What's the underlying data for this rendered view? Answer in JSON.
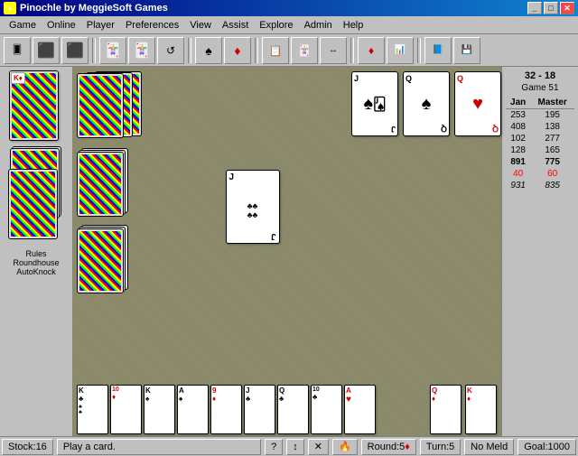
{
  "titleBar": {
    "title": "Pinochle by MeggieSoft Games",
    "icon": "♦",
    "buttons": [
      "_",
      "□",
      "✕"
    ]
  },
  "menuBar": {
    "items": [
      "Game",
      "Online",
      "Player",
      "Preferences",
      "View",
      "Assist",
      "Explore",
      "Admin",
      "Help"
    ]
  },
  "toolbar": {
    "buttons": [
      "🃏",
      "📋",
      "📋",
      "🃏",
      "🃏",
      "🔄",
      "♠",
      "♠",
      "📃",
      "🃏",
      "🔄",
      "♦",
      "📊",
      "🃏",
      "💾",
      "❓"
    ]
  },
  "scorePanel": {
    "header": "32 - 18",
    "game": "Game 51",
    "columns": [
      "Jan",
      "Master"
    ],
    "rows": [
      {
        "jan": "253",
        "master": "195",
        "type": "normal"
      },
      {
        "jan": "408",
        "master": "138",
        "type": "normal"
      },
      {
        "jan": "102",
        "master": "277",
        "type": "normal"
      },
      {
        "jan": "128",
        "master": "165",
        "type": "normal"
      },
      {
        "jan": "891",
        "master": "775",
        "type": "bold"
      },
      {
        "jan": "40",
        "master": "60",
        "type": "highlight"
      },
      {
        "jan": "931",
        "master": "835",
        "type": "italic"
      }
    ]
  },
  "leftPanel": {
    "labels": [
      "Rules",
      "Roundhouse",
      "AutoKnock"
    ]
  },
  "playArea": {
    "centerCard": {
      "rank": "J",
      "suit": "♣",
      "color": "black",
      "label": "Jack of Clubs"
    }
  },
  "playerHand": {
    "cards": [
      {
        "rank": "K",
        "suit": "♣",
        "color": "black"
      },
      {
        "rank": "10",
        "suit": "♦",
        "color": "red"
      },
      {
        "rank": "K",
        "suit": "♠",
        "color": "black"
      },
      {
        "rank": "A",
        "suit": "♠",
        "color": "black"
      },
      {
        "rank": "9",
        "suit": "♦",
        "color": "red"
      },
      {
        "rank": "J",
        "suit": "♣",
        "color": "black"
      },
      {
        "rank": "Q",
        "suit": "♣",
        "color": "black"
      },
      {
        "rank": "10",
        "suit": "♣",
        "color": "black"
      },
      {
        "rank": "A",
        "suit": "♥",
        "color": "red"
      }
    ]
  },
  "rightHand": {
    "cards": [
      {
        "rank": "Q",
        "suit": "♦",
        "color": "red"
      },
      {
        "rank": "K",
        "suit": "♦",
        "color": "red"
      }
    ]
  },
  "opponentHand": {
    "cardCount": 3,
    "faceCards": [
      {
        "rank": "J",
        "suit": "♠",
        "color": "black"
      },
      {
        "rank": "Q",
        "suit": "♠",
        "color": "black"
      },
      {
        "rank": "Q",
        "suit": "♥",
        "color": "red"
      }
    ]
  },
  "statusBar": {
    "stock": "Stock:16",
    "message": "Play a card.",
    "icons": [
      "?",
      "↕",
      "✕",
      "🔥"
    ],
    "round": "Round:5",
    "turn": "Turn:5",
    "meld": "No Meld",
    "goal": "Goal:1000"
  }
}
